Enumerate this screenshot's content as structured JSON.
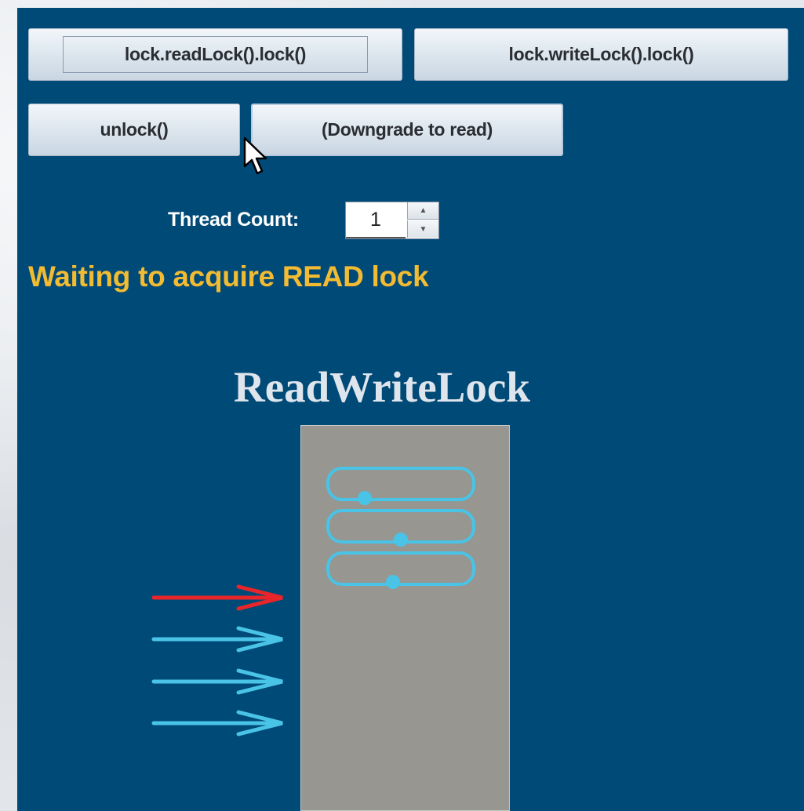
{
  "toolbar": {
    "read_lock_label": "lock.readLock().lock()",
    "write_lock_label": "lock.writeLock().lock()",
    "unlock_label": "unlock()",
    "downgrade_label": "(Downgrade to read)"
  },
  "thread_count": {
    "label": "Thread Count:",
    "value": "1"
  },
  "status": {
    "text": "Waiting to acquire READ lock",
    "color": "#f2bb32"
  },
  "diagram": {
    "title": "ReadWriteLock",
    "read_slots_held": 3,
    "waiting_threads": [
      {
        "type": "write",
        "color": "#e8262a"
      },
      {
        "type": "read",
        "color": "#49c3e6"
      },
      {
        "type": "read",
        "color": "#49c3e6"
      },
      {
        "type": "read",
        "color": "#49c3e6"
      }
    ]
  },
  "colors": {
    "panel_bg": "#004a78",
    "lock_body": "#979691",
    "read_thread": "#49c3e6",
    "write_thread": "#e8262a"
  },
  "icons": {
    "cursor": "mouse-pointer-icon",
    "spin_up": "triangle-up-icon",
    "spin_down": "triangle-down-icon"
  }
}
